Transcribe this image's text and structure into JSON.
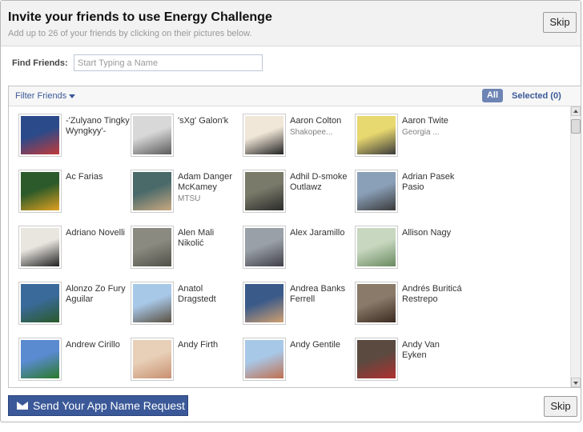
{
  "header": {
    "title": "Invite your friends to use Energy Challenge",
    "subtitle": "Add up to 26 of your friends by clicking on their pictures below.",
    "skip_label": "Skip"
  },
  "find": {
    "label": "Find Friends:",
    "placeholder": "Start Typing a Name",
    "value": ""
  },
  "filter": {
    "label": "Filter Friends",
    "all_label": "All",
    "selected_label": "Selected (0)"
  },
  "colors": {
    "accent": "#3b5998",
    "tab_active": "#6d84b4"
  },
  "friends": [
    {
      "name": "-'Zulyano Tingky Wyngkyy'-",
      "network": "",
      "photo": [
        "#2a4a8a",
        "#c23a3a"
      ]
    },
    {
      "name": "'sXg' Galon'k",
      "network": "",
      "photo": [
        "#d8d8d8",
        "#5a5a5a"
      ]
    },
    {
      "name": "Aaron Colton",
      "network": "Shakopee...",
      "photo": [
        "#f1e7d8",
        "#222222"
      ]
    },
    {
      "name": "Aaron Twite",
      "network": "Georgia ...",
      "photo": [
        "#e8d870",
        "#3a3a3a"
      ]
    },
    {
      "name": "Ac Farias",
      "network": "",
      "photo": [
        "#2c5a2a",
        "#e0a020"
      ]
    },
    {
      "name": "Adam Danger McKamey",
      "network": "MTSU",
      "photo": [
        "#4a6a6a",
        "#c9a880"
      ]
    },
    {
      "name": "Adhil D-smoke Outlawz",
      "network": "",
      "photo": [
        "#7a7a6a",
        "#2a2a2a"
      ]
    },
    {
      "name": "Adrian Pasek Pasio",
      "network": "",
      "photo": [
        "#8aa0b8",
        "#3a3a3a"
      ]
    },
    {
      "name": "Adriano Novelli",
      "network": "",
      "photo": [
        "#e9e6e0",
        "#202020"
      ]
    },
    {
      "name": "Alen Mali Nikolić",
      "network": "",
      "photo": [
        "#8a8a80",
        "#505048"
      ]
    },
    {
      "name": "Alex Jaramillo",
      "network": "",
      "photo": [
        "#9aa0a8",
        "#404048"
      ]
    },
    {
      "name": "Allison Nagy",
      "network": "",
      "photo": [
        "#c8d8c0",
        "#6a8a60"
      ]
    },
    {
      "name": "Alonzo Zo Fury Aguilar",
      "network": "",
      "photo": [
        "#3a6a9a",
        "#2a5a2a"
      ]
    },
    {
      "name": "Anatol Dragstedt",
      "network": "",
      "photo": [
        "#a8c8e8",
        "#5a5040"
      ]
    },
    {
      "name": "Andrea Banks Ferrell",
      "network": "",
      "photo": [
        "#3a5a8a",
        "#d0a070"
      ]
    },
    {
      "name": "Andrés Buriticá Restrepo",
      "network": "",
      "photo": [
        "#8a7a6a",
        "#3a2a20"
      ]
    },
    {
      "name": "Andrew Cirillo",
      "network": "",
      "photo": [
        "#5a8ad0",
        "#2a7a2a"
      ]
    },
    {
      "name": "Andy Firth",
      "network": "",
      "photo": [
        "#e8d0b8",
        "#c89070"
      ]
    },
    {
      "name": "Andy Gentile",
      "network": "",
      "photo": [
        "#a8c8e8",
        "#c07050"
      ]
    },
    {
      "name": "Andy Van Eyken",
      "network": "",
      "photo": [
        "#5a4a40",
        "#b03030"
      ]
    }
  ],
  "send_button_label": "Send Your App Name Request"
}
